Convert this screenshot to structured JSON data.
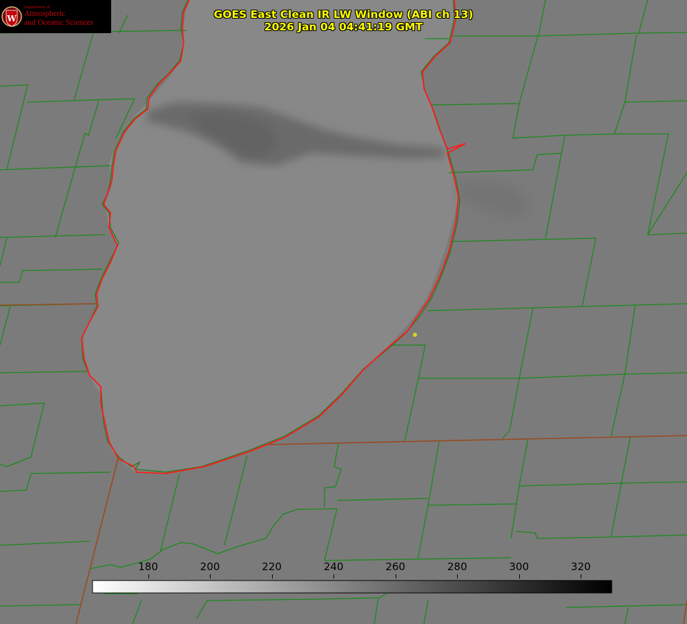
{
  "logo": {
    "department": "Department of",
    "line1": "Atmospheric",
    "line2": "and Oceanic Sciences",
    "seal_letter": "W"
  },
  "header": {
    "title_line1": "GOES East Clean IR LW Window (ABI ch 13)",
    "title_line2": "2026 Jan 04 04:41:19 GMT"
  },
  "colorbar": {
    "ticks": [
      "180",
      "200",
      "220",
      "240",
      "260",
      "280",
      "300",
      "320"
    ],
    "tick_values": [
      180,
      200,
      220,
      240,
      260,
      280,
      300,
      320
    ],
    "range": [
      162,
      330
    ],
    "gradient_start": "#ffffff",
    "gradient_end": "#000000"
  },
  "colors": {
    "background": "#7b7b7b",
    "county_lines": "#1a8a1a",
    "lake_outline": "#ff1a1a",
    "title_text": "#ffff00",
    "marker": "#e0d020"
  },
  "map_features": {
    "lake": "Lake Michigan",
    "marker": "city-dot"
  }
}
